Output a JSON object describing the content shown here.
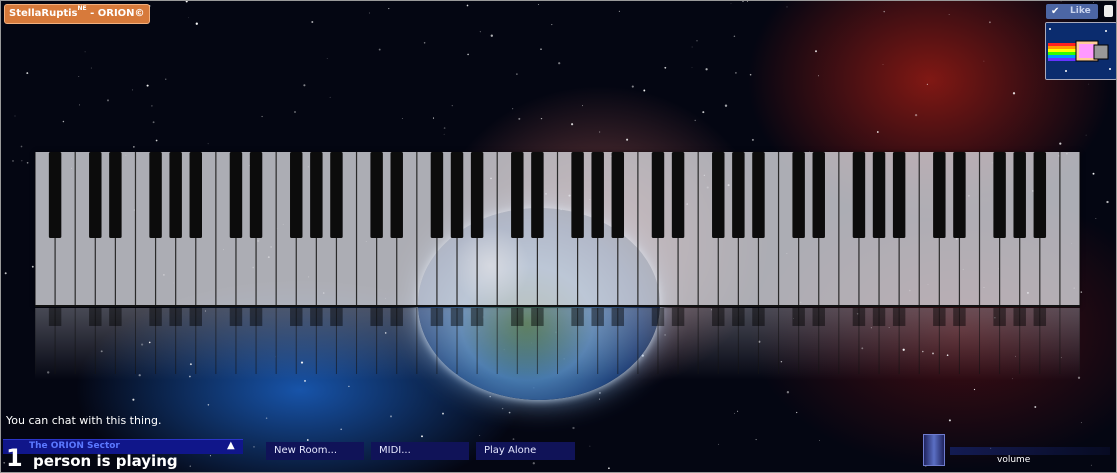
{
  "header": {
    "user_name": "StellaRuptis",
    "user_tag": "NE",
    "room_suffix": " - ORION©",
    "badge_color": "#d77a3b"
  },
  "social": {
    "like_label": "Like",
    "like_icon": "check-icon",
    "avatar_image": "nyan-cat-avatar"
  },
  "piano": {
    "white_key_count": 52,
    "background_image": "earth-in-space"
  },
  "chat": {
    "hint": "You can chat with this thing."
  },
  "room": {
    "name": "The ORION Sector",
    "toggle_icon": "caret-up-icon",
    "player_count": "1",
    "player_text": "person is playing"
  },
  "toolbar": {
    "new_room_label": "New Room...",
    "midi_label": "MIDI...",
    "play_alone_label": "Play Alone"
  },
  "volume": {
    "label": "volume"
  },
  "colors": {
    "accent_blue": "#101358",
    "room_link": "#5a78ff",
    "like_blue": "#4c66a4"
  }
}
